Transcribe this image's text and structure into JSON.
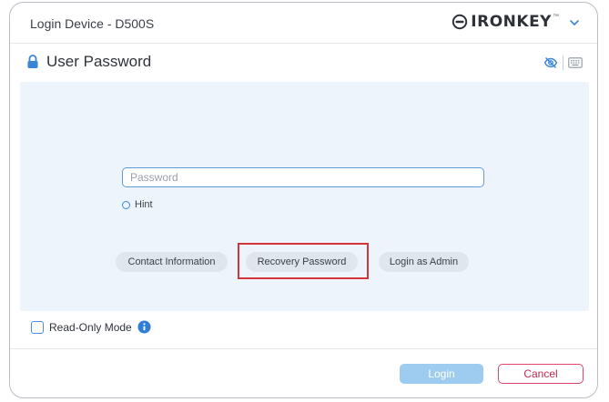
{
  "window": {
    "title": "Login Device - D500S"
  },
  "brand": {
    "name": "IRONKEY",
    "trademark": "™",
    "logo_icon": "ironkey-logo-icon",
    "menu_icon": "chevron-down-icon"
  },
  "section": {
    "title": "User Password",
    "icon": "lock-icon",
    "tools": {
      "visibility_icon": "eye-slash-icon",
      "keyboard_icon": "keyboard-icon"
    }
  },
  "form": {
    "password": {
      "value": "",
      "placeholder": "Password"
    },
    "hint_label": "Hint",
    "actions": {
      "contact_label": "Contact Information",
      "recovery_label": "Recovery Password",
      "admin_label": "Login as Admin"
    }
  },
  "footer": {
    "readonly_label": "Read-Only Mode",
    "readonly_checked": false,
    "info_icon": "info-icon",
    "login_label": "Login",
    "cancel_label": "Cancel"
  },
  "colors": {
    "accent": "#3a86d6",
    "panel_bg": "#eef4fb",
    "highlight": "#d2353a",
    "login_bg": "#9ecbf0",
    "cancel_border": "#e0466a"
  }
}
